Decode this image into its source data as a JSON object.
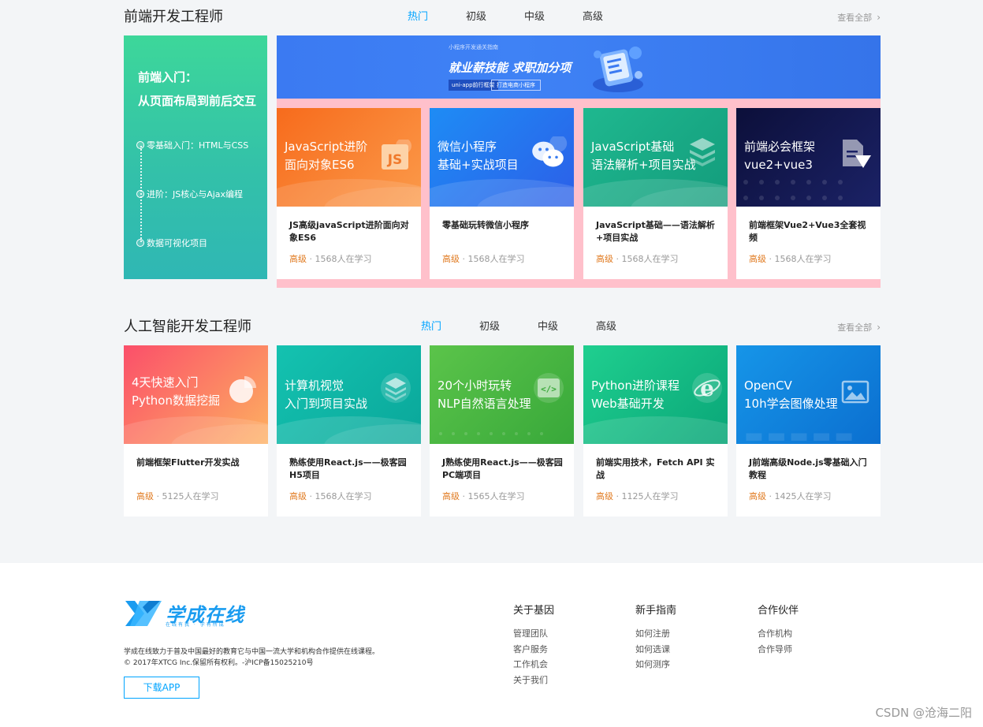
{
  "section1": {
    "title": "前端开发工程师",
    "tabs": [
      "热门",
      "初级",
      "中级",
      "高级"
    ],
    "view_all": "查看全部",
    "promo": {
      "line1": "前端入门：",
      "line2": "从页面布局到前后交互",
      "steps": [
        "零基础入门：HTML与CSS",
        "进阶：JS核心与Ajax编程",
        "数据可视化项目"
      ]
    },
    "banner": {
      "small": "小程序开发通关指南",
      "big": "就业薪技能 求职加分项",
      "pill1": "uni-app前行框架",
      "pill2": "打造电商小程序"
    },
    "cards": [
      {
        "cover": "JavaScript进阶\n面向对象ES6",
        "title": "JS高级javaScript进阶面向对象ES6",
        "level": "高级",
        "learners": " · 1568人在学习",
        "icon": "js-icon",
        "colors": [
          "#f76b1c",
          "#fb9a4a"
        ]
      },
      {
        "cover": "微信小程序\n基础+实战项目",
        "title": "零基础玩转微信小程序",
        "level": "高级",
        "learners": " · 1568人在学习",
        "icon": "wechat-icon",
        "colors": [
          "#1e8cf5",
          "#2c5fe8"
        ]
      },
      {
        "cover": "JavaScript基础\n语法解析+项目实战",
        "title": "JavaScript基础——语法解析+项目实战",
        "level": "高级",
        "learners": " · 1568人在学习",
        "icon": "layers-icon",
        "colors": [
          "#1fb88f",
          "#139c7c"
        ]
      },
      {
        "cover": "前端必会框架\nvue2+vue3",
        "title": "前端框架Vue2+Vue3全套视频",
        "level": "高级",
        "learners": " · 1568人在学习",
        "icon": "vue-doc-icon",
        "colors": [
          "#0c0f3a",
          "#1b2266"
        ]
      }
    ]
  },
  "section2": {
    "title": "人工智能开发工程师",
    "tabs": [
      "热门",
      "初级",
      "中级",
      "高级"
    ],
    "view_all": "查看全部",
    "cards": [
      {
        "cover": "4天快速入门\nPython数据挖掘",
        "title": "前端框架Flutter开发实战",
        "level": "高级",
        "learners": " · 5125人在学习",
        "icon": "pie-chart-icon",
        "colors": [
          "#fb4f6a",
          "#fdb060"
        ]
      },
      {
        "cover": "计算机视觉\n入门到项目实战",
        "title": "熟练使用React.js——极客园H5项目",
        "level": "高级",
        "learners": " · 1568人在学习",
        "icon": "layers-icon",
        "colors": [
          "#14c2b0",
          "#0aa79a"
        ]
      },
      {
        "cover": "20个小时玩转\nNLP自然语言处理",
        "title": "J熟练使用React.js——极客园PC端项目",
        "level": "高级",
        "learners": " · 1565人在学习",
        "icon": "code-icon",
        "colors": [
          "#5bc44a",
          "#38a83a"
        ]
      },
      {
        "cover": "Python进阶课程\nWeb基础开发",
        "title": "前端实用技术，Fetch API 实战",
        "level": "高级",
        "learners": " · 1125人在学习",
        "icon": "ie-icon",
        "colors": [
          "#1fcf8f",
          "#0aa678"
        ]
      },
      {
        "cover": "OpenCV\n10h学会图像处理",
        "title": "J前端高级Node.js零基础入门教程",
        "level": "高级",
        "learners": " · 1425人在学习",
        "icon": "image-icon",
        "colors": [
          "#1695e8",
          "#0b6fd0"
        ]
      }
    ]
  },
  "footer": {
    "logo_text": "学成在线",
    "logo_sub": "在线有我 · 学有所成",
    "desc1": "学成在线致力于普及中国最好的教育它与中国一流大学和机构合作提供在线课程。",
    "desc2": "© 2017年XTCG Inc.保留所有权利。-沪ICP备15025210号",
    "download": "下载APP",
    "columns": [
      {
        "heading": "关于基因",
        "links": [
          "管理团队",
          "客户服务",
          "工作机会",
          "关于我们"
        ]
      },
      {
        "heading": "新手指南",
        "links": [
          "如何注册",
          "如何选课",
          "如何测序"
        ]
      },
      {
        "heading": "合作伙伴",
        "links": [
          "合作机构",
          "合作导师"
        ]
      }
    ],
    "watermark": "CSDN @沧海二阳"
  },
  "colors": {
    "accent": "#00a4ff",
    "level": "#e07a20",
    "pink": "#ffc0cb"
  }
}
